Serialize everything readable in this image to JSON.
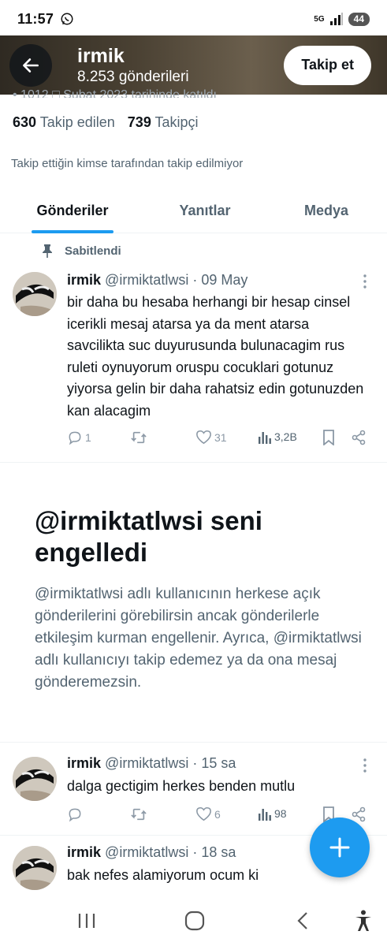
{
  "status_bar": {
    "time": "11:57",
    "network": "5G",
    "battery": "44",
    "icons": [
      "whatsapp-icon",
      "signal-icon",
      "battery-icon"
    ]
  },
  "header": {
    "name": "irmik",
    "post_count": "8.253 gönderileri",
    "follow_label": "Takip et"
  },
  "profile": {
    "peek_text": "• 1012   □ Şubat 2023 tarihinde katıldı",
    "following_count": "630",
    "following_label": "Takip edilen",
    "followers_count": "739",
    "followers_label": "Takipçi",
    "mutual_text": "Takip ettiğin kimse tarafından takip edilmiyor"
  },
  "tabs": [
    {
      "label": "Gönderiler",
      "active": true
    },
    {
      "label": "Yanıtlar",
      "active": false
    },
    {
      "label": "Medya",
      "active": false
    }
  ],
  "pinned_label": "Sabitlendi",
  "tweets": [
    {
      "name": "irmik",
      "handle": "@irmiktatlwsi",
      "time": "· 09 May",
      "text": "bir daha bu hesaba herhangi bir hesap cinsel icerikli mesaj atarsa ya da ment atarsa savcilikta suc duyurusunda bulunacagim rus ruleti oynuyorum oruspu cocuklari gotunuz yiyorsa  gelin bir daha rahatsiz edin gotunuzden kan alacagim",
      "replies": "1",
      "retweets": "",
      "likes": "31",
      "views": "3,2B"
    },
    {
      "name": "irmik",
      "handle": "@irmiktatlwsi",
      "time": "· 15 sa",
      "text": "dalga gectigim herkes benden mutlu",
      "replies": "",
      "retweets": "",
      "likes": "6",
      "views": "98"
    },
    {
      "name": "irmik",
      "handle": "@irmiktatlwsi",
      "time": "· 18 sa",
      "text": "bak nefes alamiyorum ocum ki"
    }
  ],
  "blocked": {
    "title": "@irmiktatlwsi seni engelledi",
    "description": "@irmiktatlwsi adlı kullanıcının herkese açık gönderilerini görebilirsin ancak gönderilerle etkileşim kurman engellenir. Ayrıca, @irmiktatlwsi adlı kullanıcıyı takip edemez ya da ona mesaj gönderemezsin."
  },
  "colors": {
    "accent": "#1d9bf0",
    "text_primary": "#0f1419",
    "text_secondary": "#536471",
    "divider": "#eff3f4"
  }
}
